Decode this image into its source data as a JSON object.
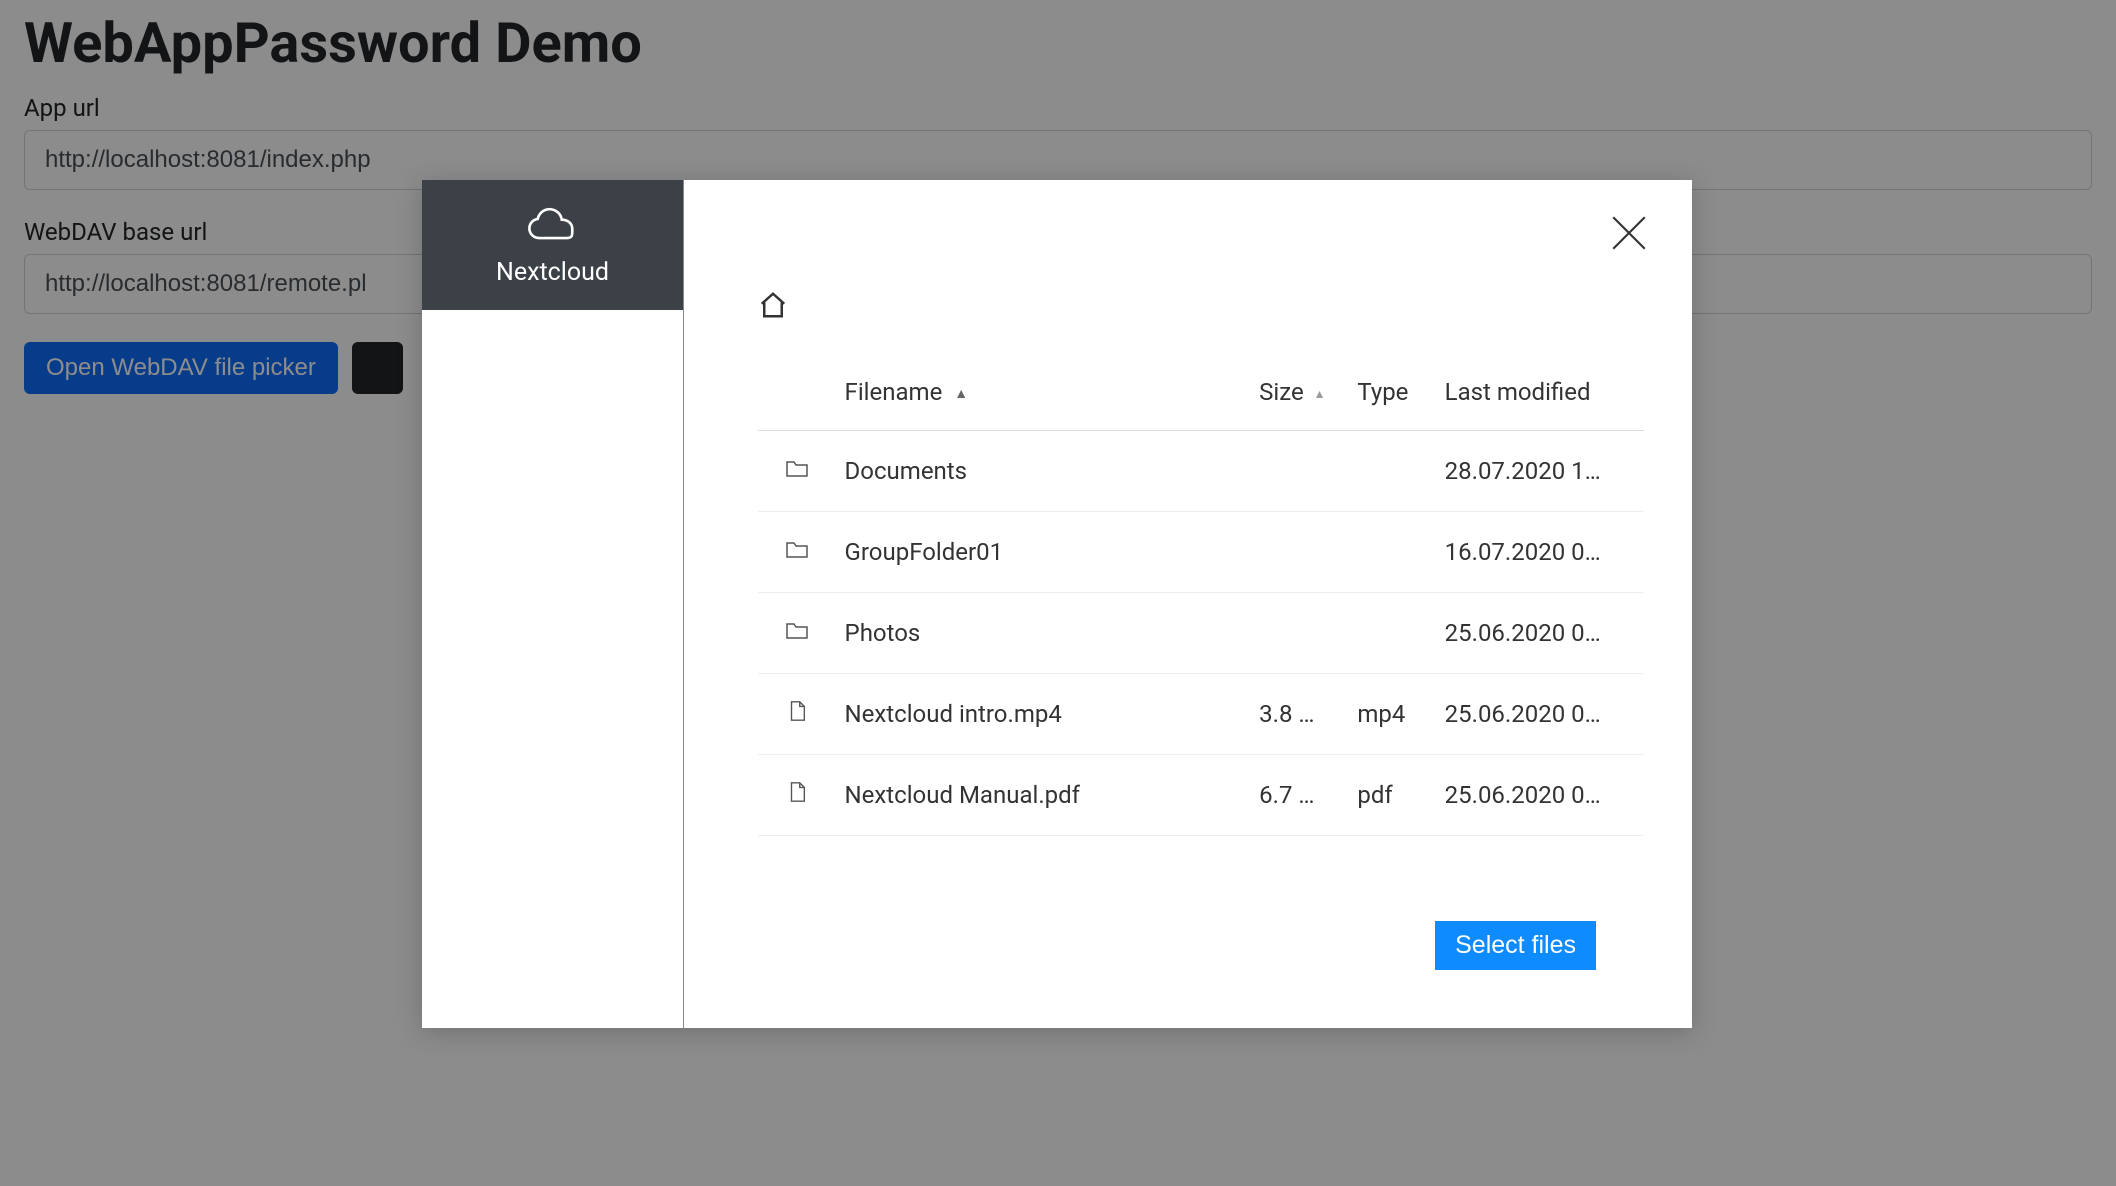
{
  "page": {
    "title": "WebAppPassword Demo",
    "app_url_label": "App url",
    "app_url_value": "http://localhost:8081/index.php",
    "webdav_label": "WebDAV base url",
    "webdav_value": "http://localhost:8081/remote.pl",
    "open_picker_button": "Open WebDAV file picker"
  },
  "modal": {
    "sidebar_title": "Nextcloud",
    "columns": {
      "filename": "Filename",
      "size": "Size",
      "type": "Type",
      "last_modified": "Last modified"
    },
    "rows": [
      {
        "icon": "folder",
        "name": "Documents",
        "size": "",
        "type": "",
        "modified": "28.07.2020 1…"
      },
      {
        "icon": "folder",
        "name": "GroupFolder01",
        "size": "",
        "type": "",
        "modified": "16.07.2020 0…"
      },
      {
        "icon": "folder",
        "name": "Photos",
        "size": "",
        "type": "",
        "modified": "25.06.2020 0…"
      },
      {
        "icon": "file",
        "name": "Nextcloud intro.mp4",
        "size": "3.8 …",
        "type": "mp4",
        "modified": "25.06.2020 0…"
      },
      {
        "icon": "file",
        "name": "Nextcloud Manual.pdf",
        "size": "6.7 …",
        "type": "pdf",
        "modified": "25.06.2020 0…"
      }
    ],
    "select_button": "Select files"
  }
}
